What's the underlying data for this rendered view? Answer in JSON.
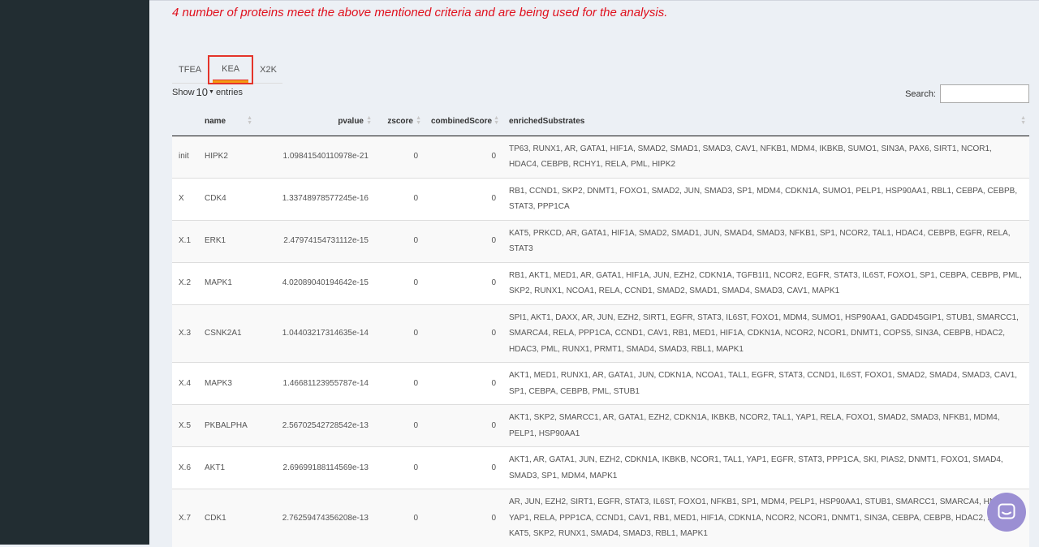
{
  "message": "4 number of proteins meet the above mentioned criteria and are being used for the analysis.",
  "tabs": [
    {
      "label": "TFEA"
    },
    {
      "label": "KEA"
    },
    {
      "label": "X2K"
    }
  ],
  "length": {
    "show": "Show",
    "value": "10",
    "entries": "entries"
  },
  "search": {
    "label": "Search:",
    "value": ""
  },
  "table": {
    "headers": [
      "",
      "name",
      "pvalue",
      "zscore",
      "combinedScore",
      "enrichedSubstrates"
    ],
    "rows": [
      {
        "id": "init",
        "name": "HIPK2",
        "pvalue": "1.09841540110978e-21",
        "zscore": "0",
        "combined": "0",
        "substrates": "TP63, RUNX1, AR, GATA1, HIF1A, SMAD2, SMAD1, SMAD3, CAV1, NFKB1, MDM4, IKBKB, SUMO1, SIN3A, PAX6, SIRT1, NCOR1, HDAC4, CEBPB, RCHY1, RELA, PML, HIPK2"
      },
      {
        "id": "X",
        "name": "CDK4",
        "pvalue": "1.33748978577245e-16",
        "zscore": "0",
        "combined": "0",
        "substrates": "RB1, CCND1, SKP2, DNMT1, FOXO1, SMAD2, JUN, SMAD3, SP1, MDM4, CDKN1A, SUMO1, PELP1, HSP90AA1, RBL1, CEBPA, CEBPB, STAT3, PPP1CA"
      },
      {
        "id": "X.1",
        "name": "ERK1",
        "pvalue": "2.47974154731112e-15",
        "zscore": "0",
        "combined": "0",
        "substrates": "KAT5, PRKCD, AR, GATA1, HIF1A, SMAD2, SMAD1, JUN, SMAD4, SMAD3, NFKB1, SP1, NCOR2, TAL1, HDAC4, CEBPB, EGFR, RELA, STAT3"
      },
      {
        "id": "X.2",
        "name": "MAPK1",
        "pvalue": "4.02089040194642e-15",
        "zscore": "0",
        "combined": "0",
        "substrates": "RB1, AKT1, MED1, AR, GATA1, HIF1A, JUN, EZH2, CDKN1A, TGFB1I1, NCOR2, EGFR, STAT3, IL6ST, FOXO1, SP1, CEBPA, CEBPB, PML, SKP2, RUNX1, NCOA1, RELA, CCND1, SMAD2, SMAD1, SMAD4, SMAD3, CAV1, MAPK1"
      },
      {
        "id": "X.3",
        "name": "CSNK2A1",
        "pvalue": "1.04403217314635e-14",
        "zscore": "0",
        "combined": "0",
        "substrates": "SPI1, AKT1, DAXX, AR, JUN, EZH2, SIRT1, EGFR, STAT3, IL6ST, FOXO1, MDM4, SUMO1, HSP90AA1, GADD45GIP1, STUB1, SMARCC1, SMARCA4, RELA, PPP1CA, CCND1, CAV1, RB1, MED1, HIF1A, CDKN1A, NCOR2, NCOR1, DNMT1, COPS5, SIN3A, CEBPB, HDAC2, HDAC3, PML, RUNX1, PRMT1, SMAD4, SMAD3, RBL1, MAPK1"
      },
      {
        "id": "X.4",
        "name": "MAPK3",
        "pvalue": "1.46681123955787e-14",
        "zscore": "0",
        "combined": "0",
        "substrates": "AKT1, MED1, RUNX1, AR, GATA1, JUN, CDKN1A, NCOA1, TAL1, EGFR, STAT3, CCND1, IL6ST, FOXO1, SMAD2, SMAD4, SMAD3, CAV1, SP1, CEBPA, CEBPB, PML, STUB1"
      },
      {
        "id": "X.5",
        "name": "PKBALPHA",
        "pvalue": "2.56702542728542e-13",
        "zscore": "0",
        "combined": "0",
        "substrates": "AKT1, SKP2, SMARCC1, AR, GATA1, EZH2, CDKN1A, IKBKB, NCOR2, TAL1, YAP1, RELA, FOXO1, SMAD2, SMAD3, NFKB1, MDM4, PELP1, HSP90AA1"
      },
      {
        "id": "X.6",
        "name": "AKT1",
        "pvalue": "2.69699188114569e-13",
        "zscore": "0",
        "combined": "0",
        "substrates": "AKT1, AR, GATA1, JUN, EZH2, CDKN1A, IKBKB, NCOR1, TAL1, YAP1, EGFR, STAT3, PPP1CA, SKI, PIAS2, DNMT1, FOXO1, SMAD4, SMAD3, SP1, MDM4, MAPK1"
      },
      {
        "id": "X.7",
        "name": "CDK1",
        "pvalue": "2.76259474356208e-13",
        "zscore": "0",
        "combined": "0",
        "substrates": "AR, JUN, EZH2, SIRT1, EGFR, STAT3, IL6ST, FOXO1, NFKB1, SP1, MDM4, PELP1, HSP90AA1, STUB1, SMARCC1, SMARCA4, HNF4A, YAP1, RELA, PPP1CA, CCND1, CAV1, RB1, MED1, HIF1A, CDKN1A, NCOR2, NCOR1, DNMT1, SIN3A, CEBPA, CEBPB, HDAC2, PML, KAT5, SKP2, RUNX1, SMAD4, SMAD3, RBL1, MAPK1"
      }
    ]
  },
  "icons": {
    "chat": "chat-bubble-icon"
  },
  "colors": {
    "message": "#e0101d",
    "sidebar": "#222d32",
    "active_tab_border": "#e4342a",
    "chat": "#9b8fd3"
  }
}
